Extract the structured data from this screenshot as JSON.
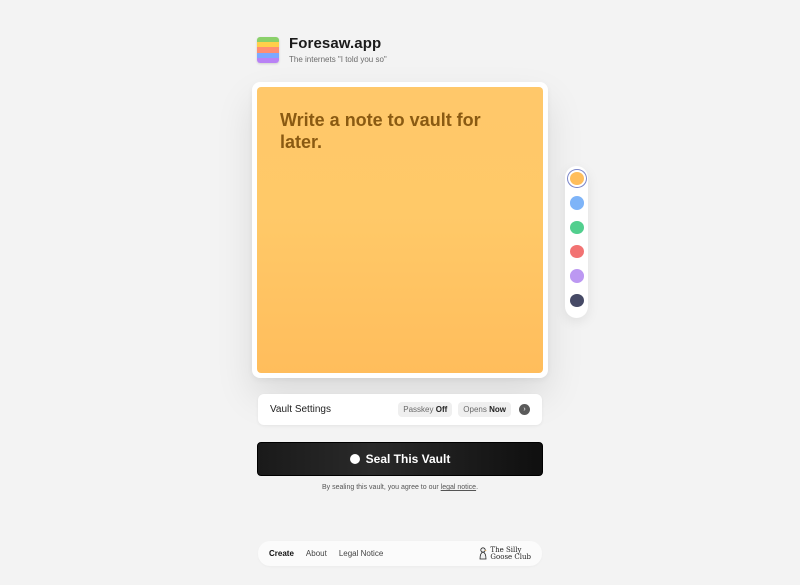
{
  "app": {
    "name": "Foresaw.app",
    "tagline": "The internets \"I told you so\"",
    "logo_colors": [
      "#8ad06a",
      "#ffcf4a",
      "#ff8e72",
      "#7ea8ff",
      "#b982f5"
    ]
  },
  "note": {
    "placeholder": "Write a note to vault for later.",
    "value": "",
    "color": "#ffc867"
  },
  "swatches": [
    {
      "name": "orange",
      "color": "#ffbe5c",
      "selected": true
    },
    {
      "name": "blue",
      "color": "#7eb4f8",
      "selected": false
    },
    {
      "name": "green",
      "color": "#52cf8e",
      "selected": false
    },
    {
      "name": "red",
      "color": "#f27373",
      "selected": false
    },
    {
      "name": "purple",
      "color": "#bc98f2",
      "selected": false
    },
    {
      "name": "navy",
      "color": "#464a66",
      "selected": false
    }
  ],
  "settings": {
    "label": "Vault Settings",
    "passkey_label": "Passkey",
    "passkey_value": "Off",
    "opens_label": "Opens",
    "opens_value": "Now"
  },
  "seal_button": {
    "label": "Seal This Vault"
  },
  "agreement": {
    "prefix": "By sealing this vault, you agree to our ",
    "link": "legal notice",
    "suffix": "."
  },
  "footer": {
    "links": [
      "Create",
      "About",
      "Legal Notice"
    ],
    "club_line1": "The Silly",
    "club_line2": "Goose Club"
  }
}
